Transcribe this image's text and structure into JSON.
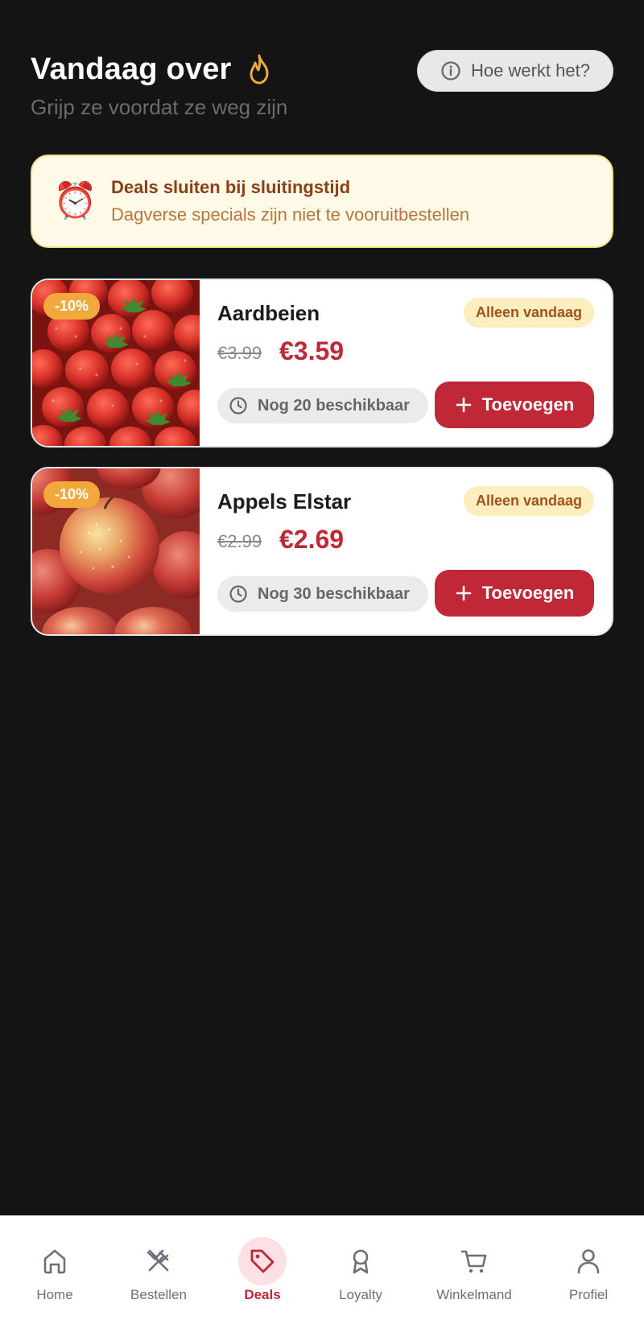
{
  "header": {
    "title": "Vandaag over",
    "subtitle": "Grijp ze voordat ze weg zijn",
    "help_button": "Hoe werkt het?"
  },
  "notice": {
    "icon": "⏰",
    "title": "Deals sluiten bij sluitingstijd",
    "text": "Dagverse specials zijn niet te vooruitbestellen"
  },
  "deals": [
    {
      "name": "Aardbeien",
      "discount": "-10%",
      "badge": "Alleen vandaag",
      "old_price": "€3.99",
      "new_price": "€3.59",
      "stock": "Nog 20 beschikbaar",
      "add_label": "Toevoegen",
      "image": "strawberries"
    },
    {
      "name": "Appels Elstar",
      "discount": "-10%",
      "badge": "Alleen vandaag",
      "old_price": "€2.99",
      "new_price": "€2.69",
      "stock": "Nog 30 beschikbaar",
      "add_label": "Toevoegen",
      "image": "apples"
    }
  ],
  "nav": {
    "items": [
      {
        "label": "Home",
        "icon": "home-icon"
      },
      {
        "label": "Bestellen",
        "icon": "utensils-icon"
      },
      {
        "label": "Deals",
        "icon": "tag-icon",
        "active": true
      },
      {
        "label": "Loyalty",
        "icon": "award-icon"
      },
      {
        "label": "Winkelmand",
        "icon": "cart-icon"
      },
      {
        "label": "Profiel",
        "icon": "user-icon"
      }
    ]
  },
  "colors": {
    "background": "#141414",
    "accent": "#c02838",
    "discount_badge": "#f0a93a",
    "notice_bg": "#fff9e8"
  }
}
